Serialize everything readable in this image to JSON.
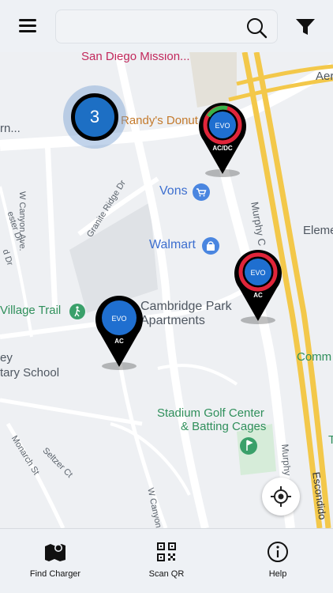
{
  "search": {
    "value": "",
    "placeholder": ""
  },
  "map": {
    "labels": {
      "san_diego_mission": "San Diego Mission...",
      "randys_donuts": "Randy's Donut",
      "vons": "Vons",
      "walmart": "Walmart",
      "cambridge_park": "Cambridge Park",
      "apartments": "Apartments",
      "village_trail": "Village Trail",
      "ey": "ey",
      "tary_school": "tary School",
      "stadium_golf": "Stadium Golf Center",
      "batting_cages": "& Batting Cages",
      "rn": "rn...",
      "aer": "Aer",
      "eleme": "Eleme",
      "comm": "Comm",
      "t_edge": "T"
    },
    "streets": {
      "w_canyon_ave": "W Canyon Ave.",
      "granite_ridge": "Granite Ridge Dr",
      "murphy_c": "Murphy C",
      "murphy": "Murphy",
      "escondido": "Escondido",
      "ester_dr": "ester Dr",
      "d_dr": "d Dr",
      "monarch_st": "Monarch St",
      "seltzer_ct": "Seltzer Ct",
      "w_canyon": "W Canyon"
    },
    "cluster_count": "3",
    "chargers": [
      {
        "type": "AC/DC",
        "logo": "EVO"
      },
      {
        "type": "AC",
        "logo": "EVO"
      },
      {
        "type": "AC",
        "logo": "EVO"
      }
    ]
  },
  "bottom_nav": {
    "find_charger": "Find Charger",
    "scan_qr": "Scan QR",
    "help": "Help"
  },
  "colors": {
    "cluster_blue": "#1d6fc4",
    "charger_blue": "#1f6fd0",
    "ring_red": "#e0253a",
    "ring_green": "#38b24a",
    "highway_yellow": "#f3c84a"
  }
}
